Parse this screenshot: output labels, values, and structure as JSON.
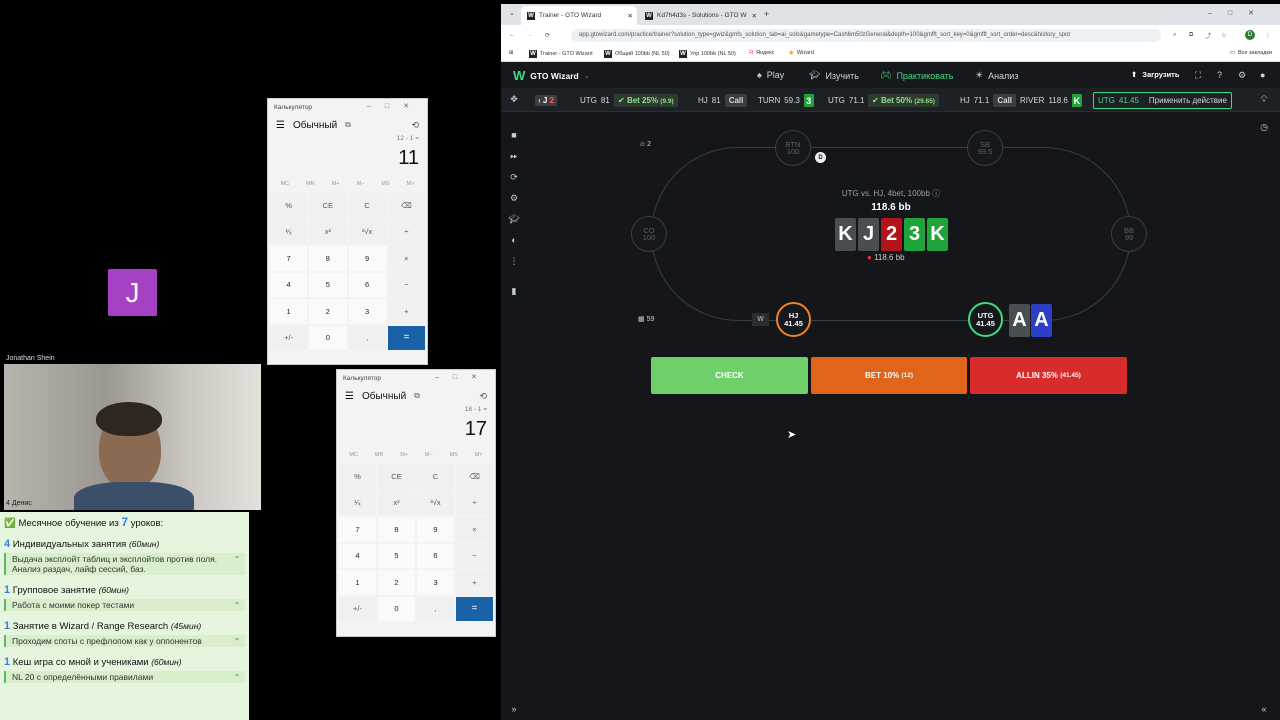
{
  "video": {
    "participant_initial": "J",
    "participant_name": "Jonathan Shein",
    "self_name": "4 Денис",
    "avatar_color": "#a542c4"
  },
  "promo": {
    "heading": "Месячное обучение из",
    "heading_count": "7",
    "heading_tail": "уроков:",
    "items": [
      {
        "count": "4",
        "title": "Индивидуальных занятия",
        "duration": "(60мин)",
        "desc": "Выдача эксплойт таблиц и эксплойтов против поля. Анализ раздач, лайф сессий, баз."
      },
      {
        "count": "1",
        "title": "Групповое занятие",
        "duration": "(60мин)",
        "desc": "Работа с моими покер тестами"
      },
      {
        "count": "1",
        "title": "Занятие в Wizard / Range Research",
        "duration": "(45мин)",
        "desc": "Проходим споты с префлопом как у оппонентов"
      },
      {
        "count": "1",
        "title": "Кеш игра со мной и учениками",
        "duration": "(60мин)",
        "desc": "NL 20 с определёнными правилами"
      }
    ]
  },
  "calc1": {
    "title": "Калькулятор",
    "mode": "Обычный",
    "expression": "12 - 1 =",
    "result": "11",
    "memory": [
      "MC",
      "MR",
      "M+",
      "M−",
      "MS",
      "M˅"
    ],
    "keys": [
      "%",
      "CE",
      "C",
      "⌫",
      "¹⁄ₓ",
      "x²",
      "²√x",
      "÷",
      "7",
      "8",
      "9",
      "×",
      "4",
      "5",
      "6",
      "−",
      "1",
      "2",
      "3",
      "+",
      "+/-",
      "0",
      ",",
      "="
    ]
  },
  "calc2": {
    "title": "Калькулятор",
    "mode": "Обычный",
    "expression": "18 - 1 =",
    "result": "17",
    "memory": [
      "MC",
      "MR",
      "M+",
      "M−",
      "MS",
      "M˅"
    ],
    "keys": [
      "%",
      "CE",
      "C",
      "⌫",
      "¹⁄ₓ",
      "x²",
      "²√x",
      "÷",
      "7",
      "8",
      "9",
      "×",
      "4",
      "5",
      "6",
      "−",
      "1",
      "2",
      "3",
      "+",
      "+/-",
      "0",
      ",",
      "="
    ]
  },
  "browser": {
    "tabs": [
      {
        "label": "Trainer - GTO Wizard",
        "active": true
      },
      {
        "label": "Kd7h4d3s - Solutions - GTO Wiz",
        "active": false
      }
    ],
    "url": "app.gtowizard.com/practice/trainer?solution_type=gwiz&gmfs_solution_tab=ai_sols&gametype=Cash6m50zGeneral&depth=100&gmfft_sort_key=0&gmfft_sort_order=desc&history_spot",
    "bookmarks": [
      "Trainer - GTO Wizard",
      "Общий 100bb (NL 50)",
      "Упр 100bb (NL 50)",
      "Яндекс",
      "Wizard"
    ],
    "bookmarks_right": "Все закладки",
    "profile_initial": "D"
  },
  "app": {
    "brand": "GTO Wizard",
    "nav": [
      "Play",
      "Изучить",
      "Практиковать",
      "Анализ"
    ],
    "upload": "Загрузить"
  },
  "action_bar": {
    "board1": [
      "J",
      "2"
    ],
    "utg1": "UTG",
    "utg1_stack": "81",
    "bet1": "Bet 25%",
    "bet1_size": "(9.9)",
    "hj1": "HJ",
    "hj1_stack": "81",
    "call1": "Call",
    "turn": "TURN",
    "turn_pot": "59.3",
    "turn_card": "3",
    "utg2": "UTG",
    "utg2_stack": "71.1",
    "bet2": "Bet 50%",
    "bet2_size": "(29.65)",
    "hj2": "HJ",
    "hj2_stack": "71.1",
    "call2": "Call",
    "river": "RIVER",
    "river_pot": "118.6",
    "river_card": "K",
    "current": "UTG",
    "current_stack": "41.45",
    "apply": "Применить действие"
  },
  "table": {
    "hand_count": "2",
    "spot_title": "UTG vs. HJ, 4bet, 100bb",
    "pot": "118.6 bb",
    "pot_small": "118.6 bb",
    "board": [
      {
        "rank": "K",
        "color": "#4a4d52"
      },
      {
        "rank": "J",
        "color": "#4a4d52"
      },
      {
        "rank": "2",
        "color": "#b3131a"
      },
      {
        "rank": "3",
        "color": "#1fa33a"
      },
      {
        "rank": "K",
        "color": "#1fa33a"
      }
    ],
    "seats": [
      {
        "pos": "BTN",
        "stack": "100"
      },
      {
        "pos": "SB",
        "stack": "99.5"
      },
      {
        "pos": "CO",
        "stack": "100"
      },
      {
        "pos": "BB",
        "stack": "99"
      },
      {
        "pos": "HJ",
        "stack": "41.45"
      },
      {
        "pos": "UTG",
        "stack": "41.45"
      }
    ],
    "dealer": "D",
    "hero_cards": [
      {
        "rank": "A",
        "color": "#4a4d52"
      },
      {
        "rank": "A",
        "color": "#2b3fc7"
      }
    ],
    "streak": "59",
    "hj_tag": "W"
  },
  "actions": {
    "check": "CHECK",
    "bet": "BET 10%",
    "bet_size": "(12)",
    "allin": "ALLIN 35%",
    "allin_size": "(41.45)"
  }
}
